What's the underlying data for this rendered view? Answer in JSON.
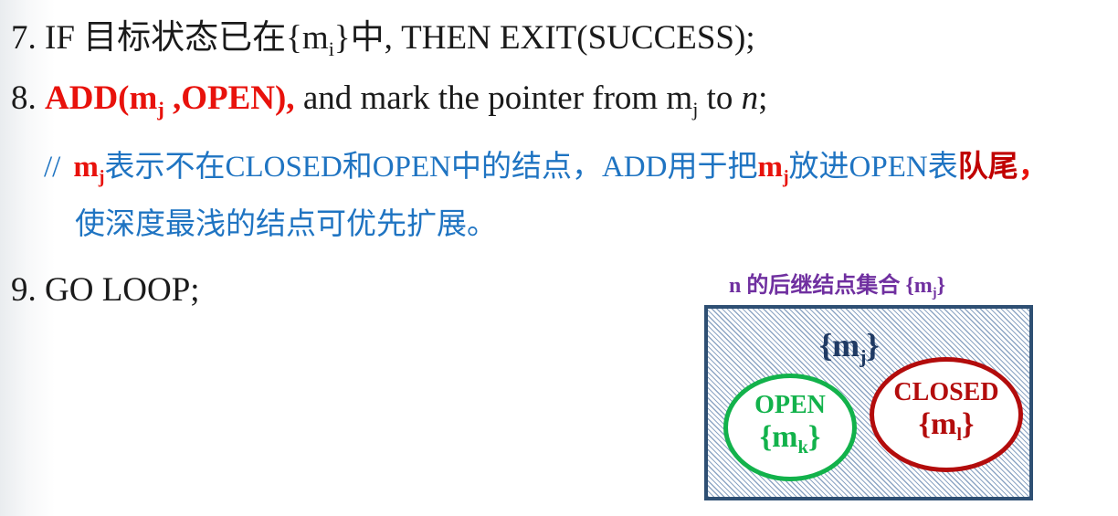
{
  "line7": {
    "prefix": "7. IF 目标状态已在{m",
    "sub": "i",
    "suffix": "}中, THEN EXIT(SUCCESS);"
  },
  "line8": {
    "number": "8. ",
    "add_prefix": "ADD(m",
    "add_sub": "j",
    "add_suffix": " ,OPEN),",
    "text_a": " and mark the pointer from m",
    "text_sub": "j",
    "text_b": " to ",
    "n": "n",
    "end": ";"
  },
  "comment": {
    "slashes": "//",
    "m": "m",
    "m_sub": "j",
    "part1": "表示不在CLOSED和OPEN中的结点，ADD用于把",
    "m2": "m",
    "m2_sub": "j",
    "part2": "放进OPEN表",
    "highlight": "队尾",
    "trail": "，",
    "line2": "使深度最浅的结点可优先扩展。"
  },
  "line9": {
    "text": "9. GO LOOP;"
  },
  "diagram": {
    "caption_prefix": "n 的后继结点集合 {m",
    "caption_sub": "j",
    "caption_suffix": "}",
    "set_prefix": "{m",
    "set_sub": "j",
    "set_suffix": "}",
    "open": {
      "title": "OPEN",
      "set_prefix": "{m",
      "set_sub": "k",
      "set_suffix": "}"
    },
    "closed": {
      "title": "CLOSED",
      "set_prefix": "{m",
      "set_sub": "l",
      "set_suffix": "}"
    }
  },
  "colors": {
    "red": "#e8120c",
    "blue": "#1f74c2",
    "purple": "#7030a0",
    "green": "#12b24b",
    "darkred": "#b30c0c",
    "navy": "#2e4f73"
  }
}
